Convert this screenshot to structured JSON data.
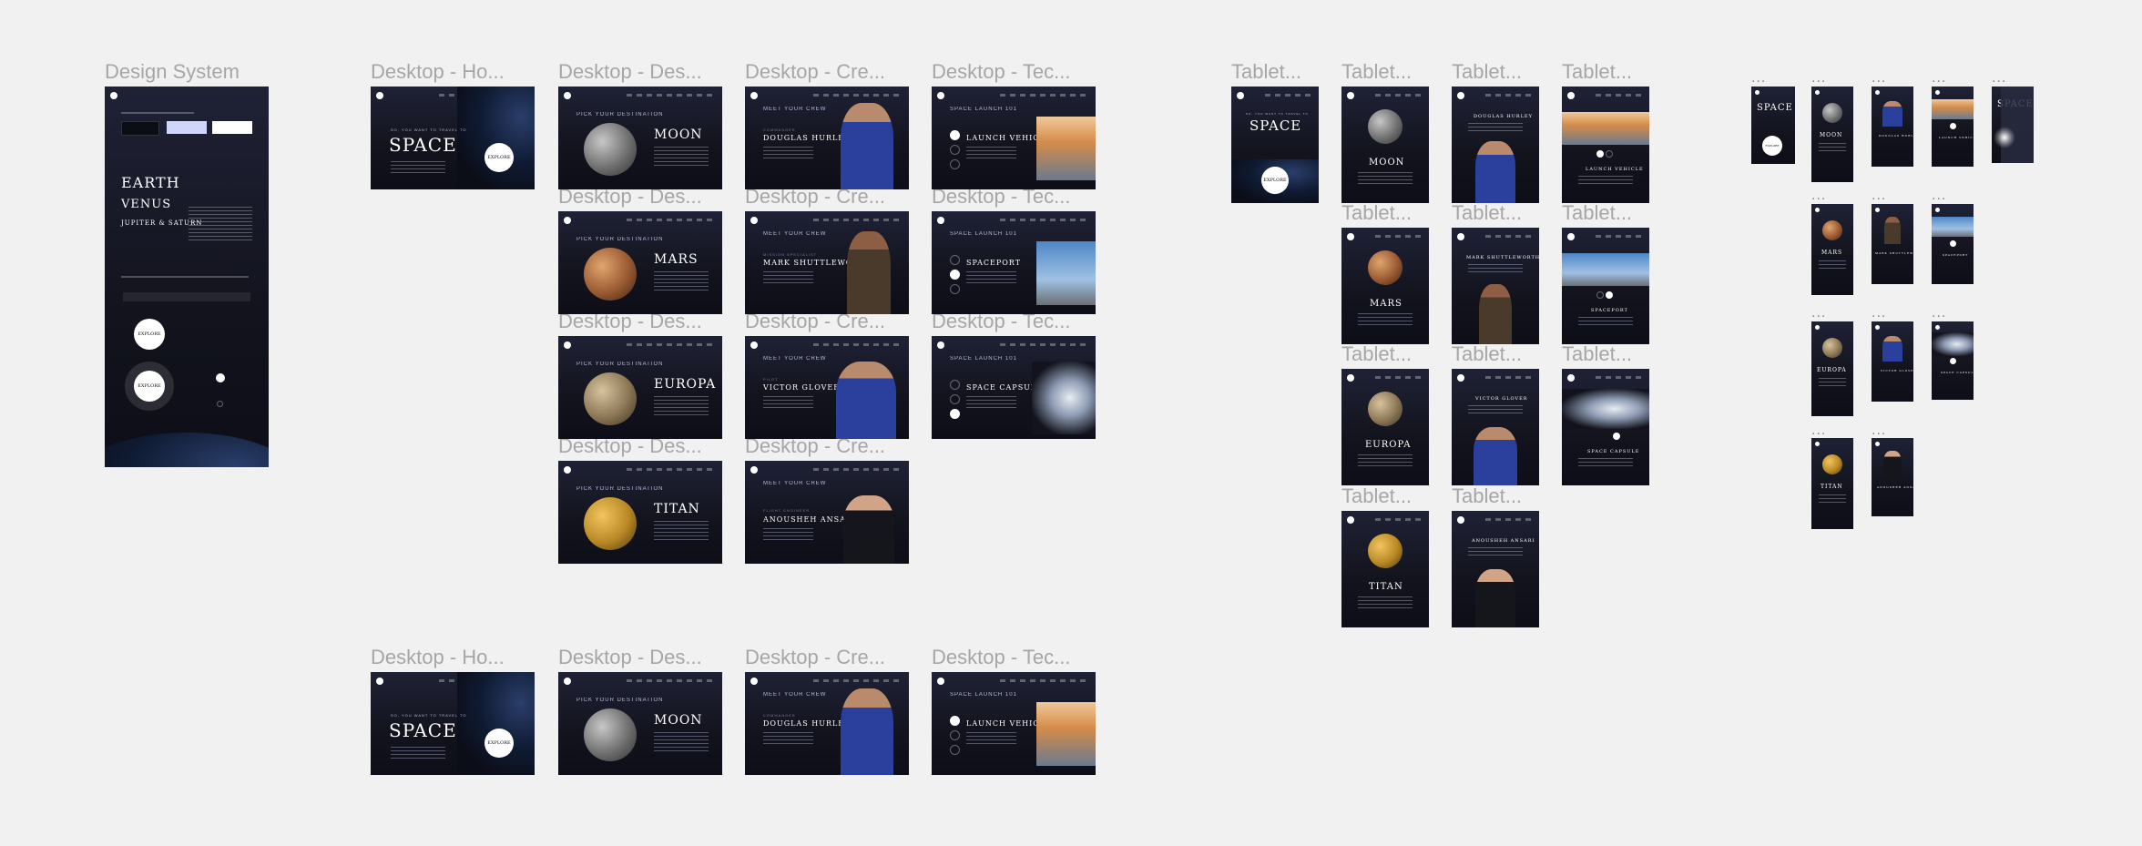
{
  "frame_labels": {
    "design_system": "Design System",
    "desktop_home": "Desktop - Ho...",
    "desktop_destination": "Desktop - Des...",
    "desktop_crew": "Desktop - Cre...",
    "desktop_technology": "Desktop - Tec...",
    "tablet": "Tablet...",
    "mobile": "..."
  },
  "design_system": {
    "earth": "EARTH",
    "venus": "VENUS",
    "jupiter_saturn": "JUPITER & SATURN",
    "explore": "EXPLORE"
  },
  "home": {
    "subtitle": "SO, YOU WANT TO TRAVEL TO",
    "title": "SPACE",
    "button": "EXPLORE"
  },
  "destination": {
    "heading": "PICK YOUR DESTINATION",
    "planets": [
      "MOON",
      "MARS",
      "EUROPA",
      "TITAN"
    ]
  },
  "crew": {
    "heading": "MEET YOUR CREW",
    "members": [
      {
        "role": "COMMANDER",
        "name": "DOUGLAS HURLEY"
      },
      {
        "role": "MISSION SPECIALIST",
        "name": "MARK SHUTTLEWORTH"
      },
      {
        "role": "PILOT",
        "name": "VICTOR GLOVER"
      },
      {
        "role": "FLIGHT ENGINEER",
        "name": "ANOUSHEH ANSARI"
      }
    ]
  },
  "technology": {
    "heading": "SPACE LAUNCH 101",
    "items": [
      "LAUNCH VEHICLE",
      "SPACEPORT",
      "SPACE CAPSULE"
    ]
  }
}
